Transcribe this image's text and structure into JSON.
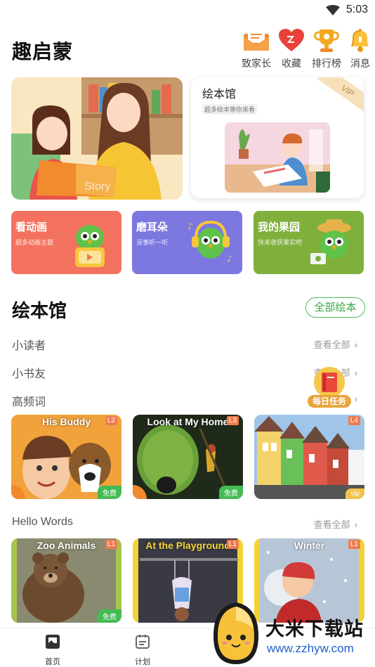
{
  "status": {
    "time": "5:03"
  },
  "header": {
    "title": "趣启蒙",
    "actions": [
      {
        "label": "致家长",
        "icon": "envelope-icon"
      },
      {
        "label": "收藏",
        "icon": "heart-icon"
      },
      {
        "label": "排行榜",
        "icon": "trophy-icon"
      },
      {
        "label": "消息",
        "icon": "bell-icon"
      }
    ]
  },
  "hero": {
    "right_title": "绘本馆",
    "right_subtitle": "超多绘本等你来看",
    "vip": "VIP",
    "left_caption": "Story"
  },
  "feature_cards": [
    {
      "title": "看动画",
      "subtitle": "超多动画主题",
      "color": "#f3725f"
    },
    {
      "title": "磨耳朵",
      "subtitle": "没事听一听",
      "color": "#7c78e0"
    },
    {
      "title": "我的果园",
      "subtitle": "快来收获果实吧",
      "color": "#7fb03c"
    }
  ],
  "section": {
    "title": "绘本馆",
    "all_button": "全部绘本"
  },
  "rows": [
    {
      "label": "小读者",
      "more": "查看全部"
    },
    {
      "label": "小书友",
      "more": "查看全部"
    },
    {
      "label": "高频词",
      "more": ""
    }
  ],
  "daily_task": "每日任务",
  "books_row1": [
    {
      "title": "His Buddy",
      "level": "L2",
      "badge": "免费"
    },
    {
      "title": "Look at My Home",
      "level": "L3",
      "badge": "免费"
    },
    {
      "title": "",
      "level": "L4",
      "badge": "vip"
    }
  ],
  "hello_words": {
    "label": "Hello Words",
    "more": "查看全部"
  },
  "books_row2": [
    {
      "title": "Zoo Animals",
      "level": "L1",
      "badge": "免费"
    },
    {
      "title": "At the Playground",
      "level": "L1",
      "badge": ""
    },
    {
      "title": "Winter",
      "level": "L1",
      "badge": ""
    }
  ],
  "tabs": [
    {
      "label": "首页",
      "icon": "home-icon"
    },
    {
      "label": "计划",
      "icon": "calendar-icon"
    }
  ],
  "watermark": {
    "name": "大米下载站",
    "url": "www.zzhyw.com"
  }
}
